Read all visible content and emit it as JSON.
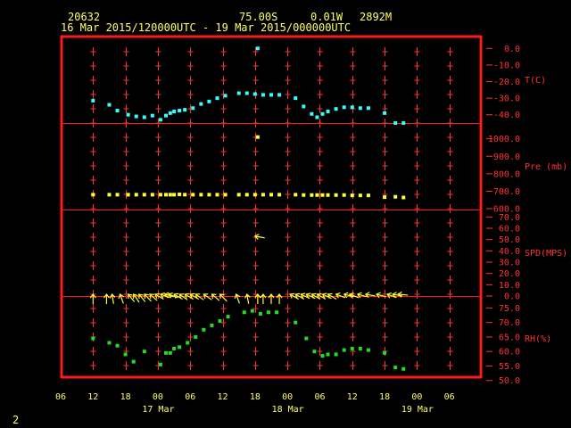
{
  "header": {
    "station": "20632",
    "lat": "75.00S",
    "lon": "0.01W",
    "elevation": "2892M",
    "time_range": "16 Mar 2015/120000UTC - 19 Mar 2015/000000UTC"
  },
  "page_number": "2",
  "colors": {
    "frame": "#ff1a1a",
    "grid": "#ff3333",
    "text": "#ffff66",
    "temperature": "#33ffff",
    "pressure": "#ffff33",
    "wind": "#ffff33",
    "humidity": "#22dd22",
    "background": "#000000"
  },
  "chart_data": {
    "type": "scatter",
    "x_axis": {
      "hour_labels": [
        "06",
        "12",
        "18",
        "00",
        "06",
        "12",
        "18",
        "00",
        "06",
        "12",
        "18",
        "00",
        "06"
      ],
      "date_labels": [
        {
          "label": "17 Mar",
          "at_hour": 60
        },
        {
          "label": "18 Mar",
          "at_hour": 84
        },
        {
          "label": "19 Mar",
          "at_hour": 108
        }
      ],
      "range_hours": [
        42,
        120
      ]
    },
    "panels": [
      {
        "id": "temperature",
        "label": "T(C)",
        "ticks": [
          "0.0",
          "-10.0",
          "-20.0",
          "-30.0",
          "-40.0"
        ],
        "ylim": [
          -45,
          5
        ],
        "series": [
          {
            "hour": 48,
            "value": -31.5
          },
          {
            "hour": 51,
            "value": -34.0
          },
          {
            "hour": 52.5,
            "value": -37.5
          },
          {
            "hour": 54.5,
            "value": -40.0
          },
          {
            "hour": 56,
            "value": -41.0
          },
          {
            "hour": 57.5,
            "value": -41.5
          },
          {
            "hour": 59,
            "value": -40.5
          },
          {
            "hour": 60.5,
            "value": -43.0
          },
          {
            "hour": 61.5,
            "value": -40.5
          },
          {
            "hour": 62.3,
            "value": -39.0
          },
          {
            "hour": 63,
            "value": -38.0
          },
          {
            "hour": 64,
            "value": -37.5
          },
          {
            "hour": 65,
            "value": -37.0
          },
          {
            "hour": 66.5,
            "value": -36.0
          },
          {
            "hour": 68,
            "value": -33.5
          },
          {
            "hour": 69.5,
            "value": -32.0
          },
          {
            "hour": 71,
            "value": -30.0
          },
          {
            "hour": 72.5,
            "value": -28.5
          },
          {
            "hour": 75,
            "value": -27.0
          },
          {
            "hour": 76.5,
            "value": -27.0
          },
          {
            "hour": 78.5,
            "value": 0.0
          },
          {
            "hour": 78,
            "value": -27.5
          },
          {
            "hour": 79.5,
            "value": -28.0
          },
          {
            "hour": 81,
            "value": -28.0
          },
          {
            "hour": 82.5,
            "value": -28.0
          },
          {
            "hour": 85.5,
            "value": -30.0
          },
          {
            "hour": 87,
            "value": -35.0
          },
          {
            "hour": 88.5,
            "value": -39.5
          },
          {
            "hour": 89.5,
            "value": -41.5
          },
          {
            "hour": 90.5,
            "value": -39.5
          },
          {
            "hour": 91.5,
            "value": -38.0
          },
          {
            "hour": 93,
            "value": -36.5
          },
          {
            "hour": 94.5,
            "value": -35.5
          },
          {
            "hour": 96,
            "value": -35.5
          },
          {
            "hour": 97.5,
            "value": -36.0
          },
          {
            "hour": 99,
            "value": -36.0
          },
          {
            "hour": 102,
            "value": -39.0
          },
          {
            "hour": 104,
            "value": -45.0
          },
          {
            "hour": 105.5,
            "value": -45.0
          }
        ]
      },
      {
        "id": "pressure",
        "label": "Pre (mb)",
        "ticks": [
          "1000.0",
          "900.0",
          "800.0",
          "700.0",
          "600.0"
        ],
        "ylim": [
          595,
          1080
        ],
        "series": [
          {
            "hour": 48,
            "value": 680
          },
          {
            "hour": 51,
            "value": 680
          },
          {
            "hour": 52.5,
            "value": 680
          },
          {
            "hour": 54.5,
            "value": 680
          },
          {
            "hour": 56,
            "value": 680
          },
          {
            "hour": 57.5,
            "value": 680
          },
          {
            "hour": 59,
            "value": 680
          },
          {
            "hour": 60.5,
            "value": 680
          },
          {
            "hour": 61.5,
            "value": 680
          },
          {
            "hour": 62.3,
            "value": 680
          },
          {
            "hour": 63,
            "value": 680
          },
          {
            "hour": 64,
            "value": 682
          },
          {
            "hour": 65,
            "value": 680
          },
          {
            "hour": 66.5,
            "value": 680
          },
          {
            "hour": 68,
            "value": 680
          },
          {
            "hour": 69.5,
            "value": 680
          },
          {
            "hour": 71,
            "value": 680
          },
          {
            "hour": 72.5,
            "value": 680
          },
          {
            "hour": 75,
            "value": 680
          },
          {
            "hour": 76.5,
            "value": 680
          },
          {
            "hour": 78.5,
            "value": 1010
          },
          {
            "hour": 78,
            "value": 680
          },
          {
            "hour": 79.5,
            "value": 680
          },
          {
            "hour": 81,
            "value": 680
          },
          {
            "hour": 82.5,
            "value": 680
          },
          {
            "hour": 85.5,
            "value": 680
          },
          {
            "hour": 87,
            "value": 678
          },
          {
            "hour": 88.5,
            "value": 678
          },
          {
            "hour": 89.5,
            "value": 678
          },
          {
            "hour": 90.5,
            "value": 678
          },
          {
            "hour": 91.5,
            "value": 678
          },
          {
            "hour": 93,
            "value": 678
          },
          {
            "hour": 94.5,
            "value": 678
          },
          {
            "hour": 96,
            "value": 676
          },
          {
            "hour": 97.5,
            "value": 676
          },
          {
            "hour": 99,
            "value": 676
          },
          {
            "hour": 102,
            "value": 666
          },
          {
            "hour": 104,
            "value": 668
          },
          {
            "hour": 105.5,
            "value": 664
          }
        ]
      },
      {
        "id": "wind",
        "label": "SPD(MPS)",
        "ticks": [
          "70.0",
          "60.0",
          "50.0",
          "40.0",
          "30.0",
          "20.0",
          "10.0",
          "0.0"
        ],
        "ylim": [
          0,
          75
        ],
        "series": [
          {
            "hour": 48,
            "dir": 0
          },
          {
            "hour": 50.5,
            "dir": 0
          },
          {
            "hour": 51.5,
            "dir": 10
          },
          {
            "hour": 53,
            "dir": 20
          },
          {
            "hour": 54.5,
            "dir": 40
          },
          {
            "hour": 55.5,
            "dir": 35
          },
          {
            "hour": 56.5,
            "dir": 40
          },
          {
            "hour": 57.5,
            "dir": 45
          },
          {
            "hour": 58.5,
            "dir": 50
          },
          {
            "hour": 59.5,
            "dir": 60
          },
          {
            "hour": 60.5,
            "dir": 70
          },
          {
            "hour": 61.3,
            "dir": 75
          },
          {
            "hour": 62,
            "dir": 70
          },
          {
            "hour": 63,
            "dir": 60
          },
          {
            "hour": 64,
            "dir": 55
          },
          {
            "hour": 65,
            "dir": 60
          },
          {
            "hour": 66,
            "dir": 60
          },
          {
            "hour": 67,
            "dir": 55
          },
          {
            "hour": 68.5,
            "dir": 55
          },
          {
            "hour": 70,
            "dir": 50
          },
          {
            "hour": 71.5,
            "dir": 45
          },
          {
            "hour": 74.5,
            "dir": 20
          },
          {
            "hour": 76.5,
            "dir": 10
          },
          {
            "hour": 78.5,
            "dir": 0
          },
          {
            "hour": 79.5,
            "dir": 0
          },
          {
            "hour": 81,
            "dir": 0
          },
          {
            "hour": 82.5,
            "dir": 0
          },
          {
            "hour": 84.5,
            "dir": 60
          },
          {
            "hour": 85.5,
            "dir": 60
          },
          {
            "hour": 86.5,
            "dir": 65
          },
          {
            "hour": 87.5,
            "dir": 65
          },
          {
            "hour": 88.5,
            "dir": 60
          },
          {
            "hour": 89.5,
            "dir": 60
          },
          {
            "hour": 90.5,
            "dir": 65
          },
          {
            "hour": 91.5,
            "dir": 60
          },
          {
            "hour": 93,
            "dir": 70
          },
          {
            "hour": 94.5,
            "dir": 75
          },
          {
            "hour": 95.5,
            "dir": 70
          },
          {
            "hour": 97,
            "dir": 75
          },
          {
            "hour": 98.5,
            "dir": 80
          },
          {
            "hour": 100.5,
            "dir": 75
          },
          {
            "hour": 102.5,
            "dir": 70
          },
          {
            "hour": 103.5,
            "dir": 80
          },
          {
            "hour": 104.5,
            "dir": 85
          },
          {
            "hour": 78,
            "dir": 80,
            "value": 53
          }
        ]
      },
      {
        "id": "humidity",
        "label": "RH(%)",
        "ticks": [
          "75.0",
          "70.0",
          "65.0",
          "60.0",
          "55.0",
          "50.0"
        ],
        "ylim": [
          49,
          78.5
        ],
        "series": [
          {
            "hour": 48,
            "value": 64.5
          },
          {
            "hour": 51,
            "value": 63.0
          },
          {
            "hour": 52.5,
            "value": 62.0
          },
          {
            "hour": 54,
            "value": 59.0
          },
          {
            "hour": 55.5,
            "value": 56.5
          },
          {
            "hour": 57.5,
            "value": 60.0
          },
          {
            "hour": 60.5,
            "value": 55.5
          },
          {
            "hour": 61.5,
            "value": 59.5
          },
          {
            "hour": 62.3,
            "value": 59.5
          },
          {
            "hour": 63,
            "value": 61.0
          },
          {
            "hour": 64,
            "value": 61.5
          },
          {
            "hour": 65.5,
            "value": 63.0
          },
          {
            "hour": 67,
            "value": 65.0
          },
          {
            "hour": 68.5,
            "value": 67.5
          },
          {
            "hour": 70,
            "value": 69.0
          },
          {
            "hour": 71.5,
            "value": 70.5
          },
          {
            "hour": 73,
            "value": 72.0
          },
          {
            "hour": 76,
            "value": 73.5
          },
          {
            "hour": 77.5,
            "value": 74.0
          },
          {
            "hour": 79,
            "value": 73.0
          },
          {
            "hour": 80.5,
            "value": 73.5
          },
          {
            "hour": 82,
            "value": 73.5
          },
          {
            "hour": 85.5,
            "value": 70.0
          },
          {
            "hour": 87.5,
            "value": 64.5
          },
          {
            "hour": 89,
            "value": 60.0
          },
          {
            "hour": 90.5,
            "value": 58.5
          },
          {
            "hour": 91.5,
            "value": 59.0
          },
          {
            "hour": 93,
            "value": 59.0
          },
          {
            "hour": 94.5,
            "value": 60.5
          },
          {
            "hour": 96,
            "value": 61.0
          },
          {
            "hour": 97.5,
            "value": 61.0
          },
          {
            "hour": 99,
            "value": 60.5
          },
          {
            "hour": 102,
            "value": 59.5
          },
          {
            "hour": 104,
            "value": 54.5
          },
          {
            "hour": 105.5,
            "value": 54.0
          }
        ]
      }
    ]
  }
}
